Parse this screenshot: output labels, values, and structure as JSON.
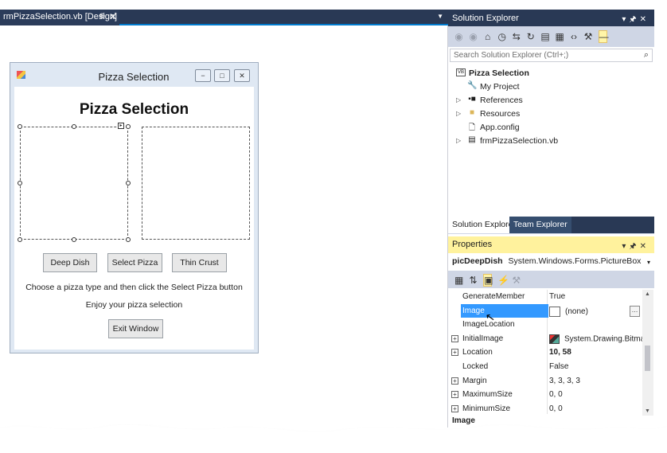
{
  "document_tab": {
    "title": "rmPizzaSelection.vb [Design]",
    "pin_icon": "pin-icon",
    "close_icon": "close-icon",
    "overflow_icon": "dropdown-arrow-icon"
  },
  "form": {
    "title": "Pizza Selection",
    "minimize": "minimize-icon",
    "maximize": "maximize-icon",
    "close": "close-icon",
    "heading": "Pizza Selection",
    "buttons": {
      "deep_dish": "Deep Dish",
      "select_pizza": "Select Pizza",
      "thin_crust": "Thin Crust",
      "exit_window": "Exit Window"
    },
    "instructions": "Choose a pizza type and then click the Select Pizza button",
    "enjoy": "Enjoy your pizza selection"
  },
  "solution_explorer": {
    "title": "Solution Explorer",
    "search_placeholder": "Search Solution Explorer (Ctrl+;)",
    "items": [
      {
        "label": "Pizza Selection",
        "icon": "vb-project-icon",
        "bold": true
      },
      {
        "label": "My Project",
        "icon": "wrench-icon"
      },
      {
        "label": "References",
        "icon": "references-icon"
      },
      {
        "label": "Resources",
        "icon": "folder-icon"
      },
      {
        "label": "App.config",
        "icon": "config-file-icon"
      },
      {
        "label": "frmPizzaSelection.vb",
        "icon": "form-file-icon"
      }
    ],
    "tabs": [
      "Solution Explorer",
      "Team Explorer"
    ]
  },
  "properties": {
    "title": "Properties",
    "object_name": "picDeepDish",
    "object_type": "System.Windows.Forms.PictureBox",
    "rows": [
      {
        "name": "GenerateMember",
        "value": "True"
      },
      {
        "name": "Image",
        "value": "(none)"
      },
      {
        "name": "ImageLocation",
        "value": ""
      },
      {
        "name": "InitialImage",
        "value": "System.Drawing.Bitmap"
      },
      {
        "name": "Location",
        "value": "10, 58"
      },
      {
        "name": "Locked",
        "value": "False"
      },
      {
        "name": "Margin",
        "value": "3, 3, 3, 3"
      },
      {
        "name": "MaximumSize",
        "value": "0, 0"
      },
      {
        "name": "MinimumSize",
        "value": "0, 0"
      }
    ],
    "description_title": "Image"
  },
  "colors": {
    "vs_dark_blue": "#293955",
    "toolbar_gray": "#cfd6e5",
    "properties_yellow": "#fff29d",
    "selection_blue": "#3399ff"
  }
}
